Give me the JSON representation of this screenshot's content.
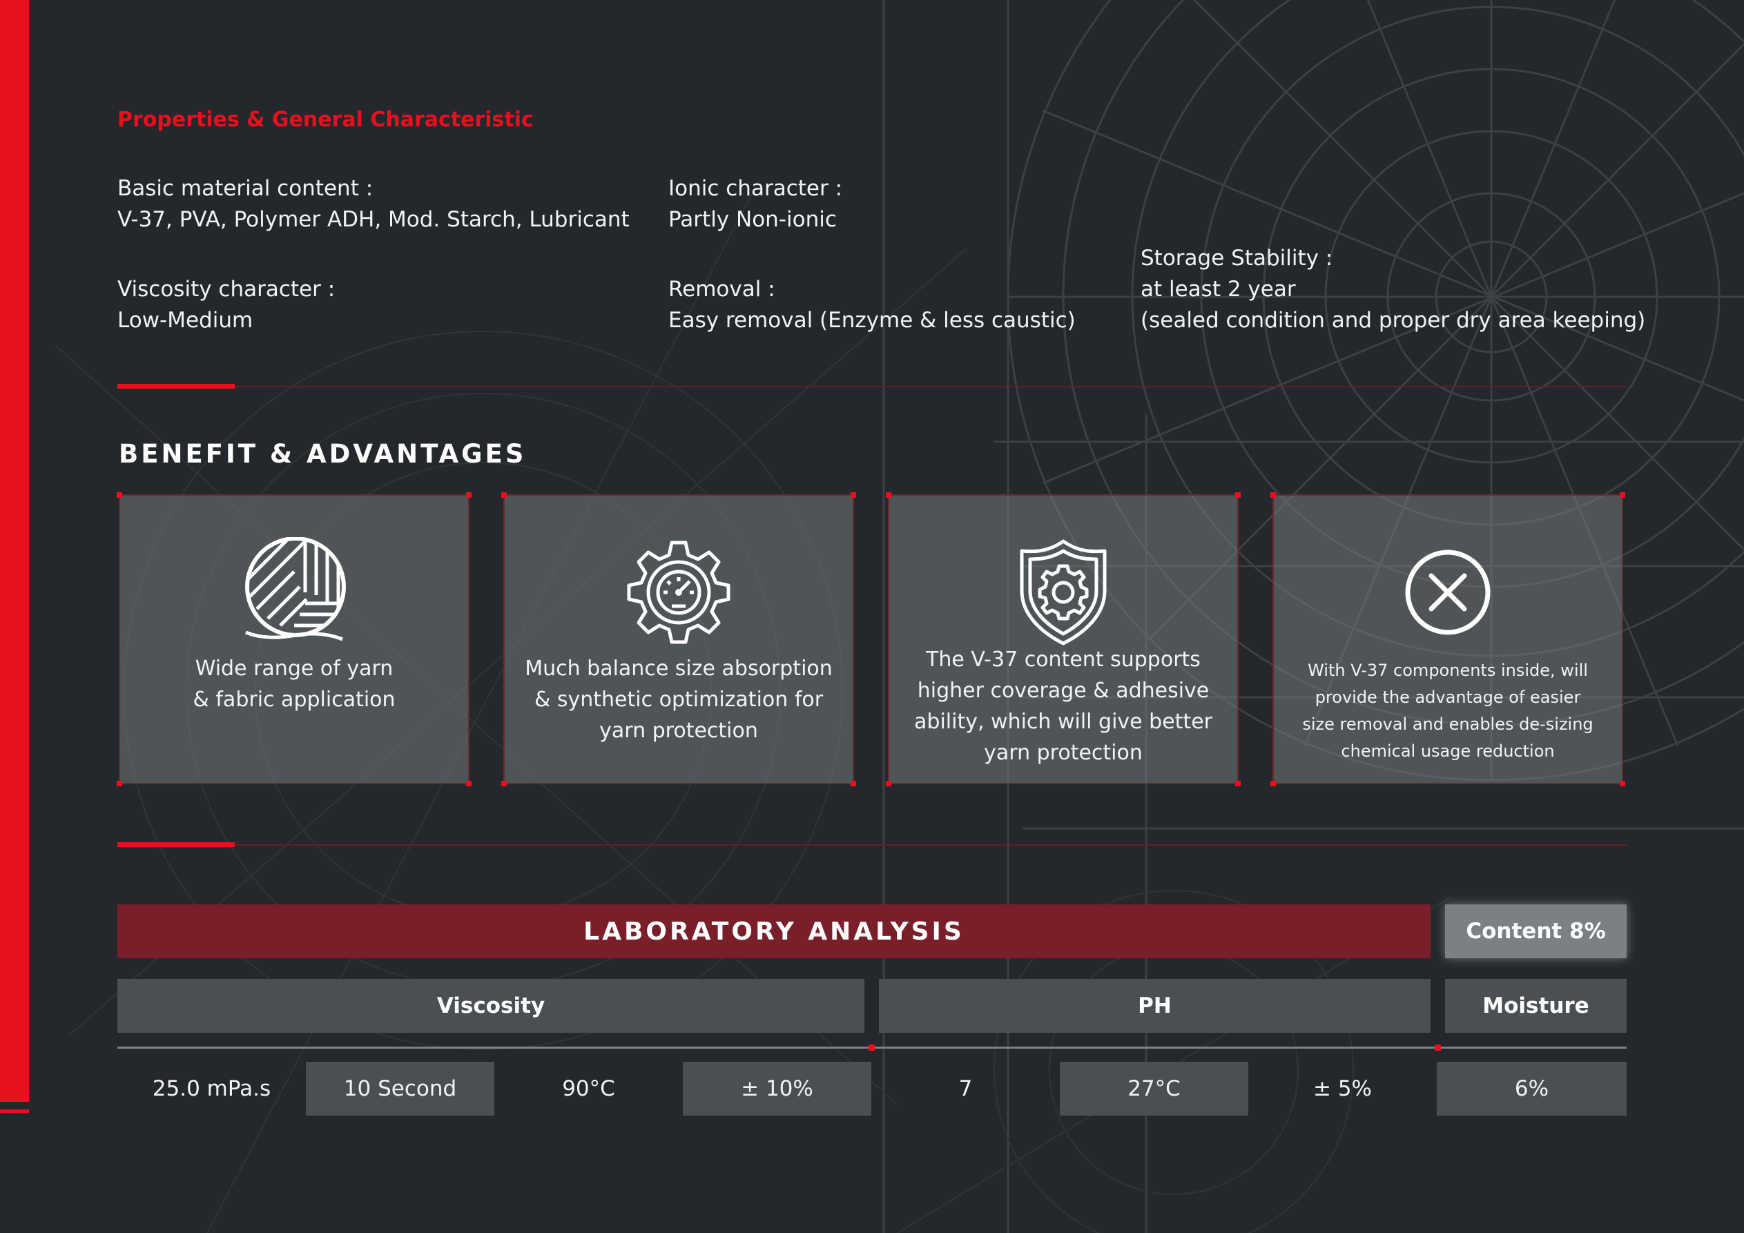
{
  "colors": {
    "accent": "#e8101e",
    "background": "#24282c",
    "lab_header": "#7a1f2a",
    "card": "#5a5f63"
  },
  "properties": {
    "title": "Properties & General Characteristic",
    "basic_label": "Basic material content :",
    "basic_value": "V-37, PVA, Polymer ADH, Mod. Starch, Lubricant",
    "ionic_label": "Ionic character :",
    "ionic_value": "Partly Non-ionic",
    "viscosity_label": "Viscosity character :",
    "viscosity_value": "Low-Medium",
    "removal_label": "Removal :",
    "removal_value": "Easy removal (Enzyme & less caustic)",
    "storage_label": "Storage Stability :",
    "storage_value": "at least 2 year",
    "storage_note": "(sealed condition and proper dry area keeping)"
  },
  "benefits": {
    "title": "BENEFIT & ADVANTAGES",
    "cards": [
      {
        "icon": "yarn-ball-icon",
        "lines": [
          "Wide range of yarn",
          "& fabric application"
        ]
      },
      {
        "icon": "gear-gauge-icon",
        "lines": [
          "Much balance size absorption",
          "& synthetic optimization for",
          "yarn protection"
        ]
      },
      {
        "icon": "shield-gear-icon",
        "lines": [
          "The V-37 content supports",
          "higher coverage & adhesive",
          "ability, which will give better",
          "yarn protection"
        ]
      },
      {
        "icon": "x-circle-icon",
        "lines": [
          "With V-37 components inside, will",
          "provide the advantage of easier",
          "size removal and enables de-sizing",
          "chemical usage reduction"
        ]
      }
    ]
  },
  "lab": {
    "title": "LABORATORY ANALYSIS",
    "content": "Content 8%",
    "headers": {
      "viscosity": "Viscosity",
      "ph": "PH",
      "moisture": "Moisture"
    },
    "values": [
      "25.0 mPa.s",
      "10 Second",
      "90°C",
      "± 10%",
      "7",
      "27°C",
      "± 5%",
      "6%"
    ]
  }
}
